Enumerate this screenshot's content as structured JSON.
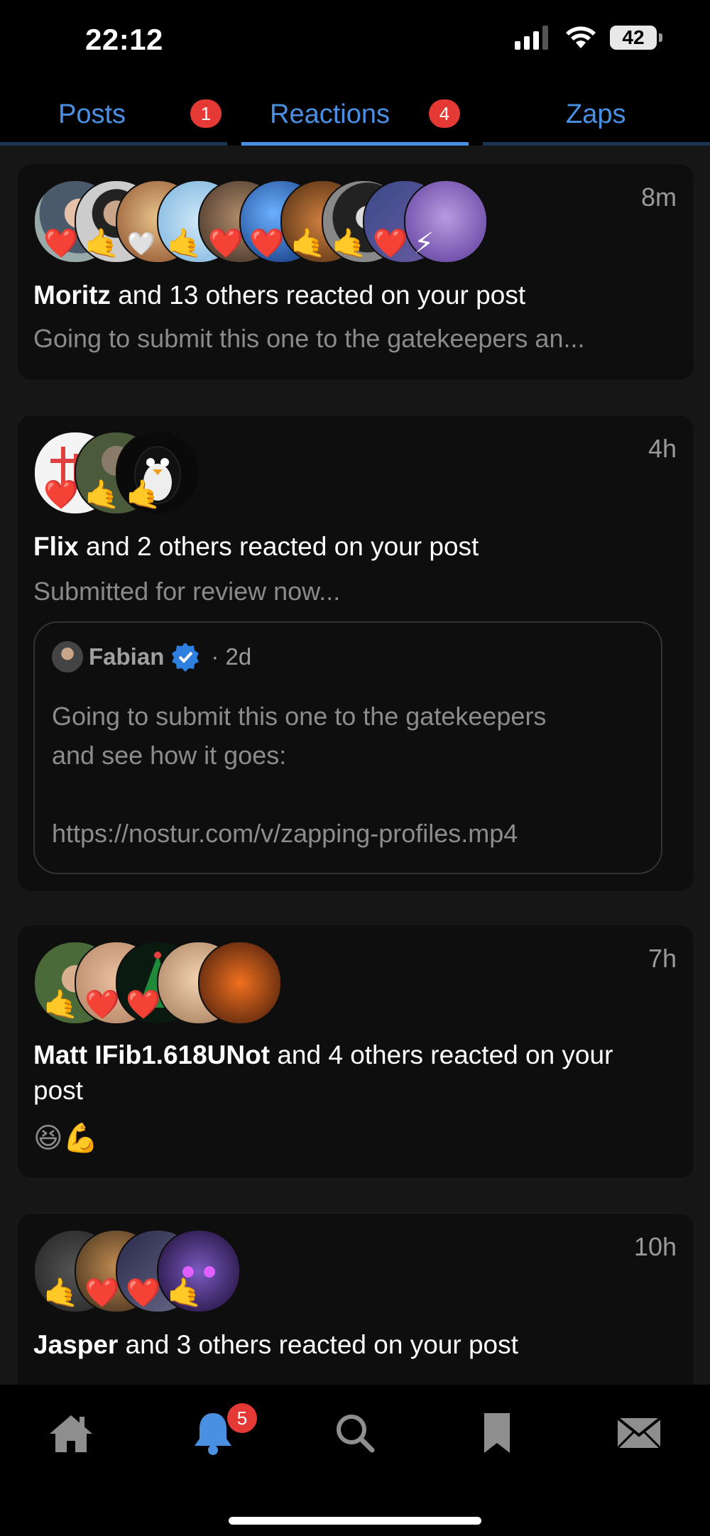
{
  "status": {
    "time": "22:12",
    "battery": "42"
  },
  "tabs": [
    {
      "label": "Posts",
      "badge": "1"
    },
    {
      "label": "Reactions",
      "badge": "4",
      "active": true
    },
    {
      "label": "Zaps"
    }
  ],
  "colors": {
    "accent": "#4a90e2",
    "badge": "#e53935",
    "background": "#000000",
    "card": "#0e0e0e"
  },
  "cards": [
    {
      "ago": "8m",
      "name": "Moritz",
      "text": " and 13 others reacted on your post",
      "snippet": "Going to submit this one to the gatekeepers an...",
      "reactions": [
        "❤️",
        "🤙",
        "🤍",
        "🤙",
        "❤️",
        "❤️",
        "🤙",
        "🤙",
        "❤️",
        "⚡"
      ]
    },
    {
      "ago": "4h",
      "name": "Flix",
      "text": " and 2 others reacted on your post",
      "snippet": "Submitted for review now...",
      "reactions": [
        "❤️",
        "🤙",
        "🤙"
      ],
      "quoted": {
        "author": "Fabian",
        "ago": "· 2d",
        "body_line1": "Going to submit this one to the gatekeepers",
        "body_line2": "and see how it goes:",
        "body_link": "https://nostur.com/v/zapping-profiles.mp4"
      }
    },
    {
      "ago": "7h",
      "name": "Matt IFib1.618UNot",
      "text": " and 4 others reacted on your post",
      "snippet": "😆💪",
      "reactions": [
        "🤙",
        "❤️",
        "❤️",
        "",
        ""
      ]
    },
    {
      "ago": "10h",
      "name": "Jasper",
      "text": " and 3 others reacted on your post",
      "snippet": "",
      "reactions": [
        "🤙",
        "❤️",
        "❤️",
        "🤙"
      ]
    }
  ],
  "nav": {
    "notifications_badge": "5"
  },
  "icons": [
    "signal-icon",
    "wifi-icon",
    "battery-icon",
    "home-icon",
    "bell-icon",
    "search-icon",
    "bookmark-icon",
    "mail-icon",
    "verified-icon"
  ]
}
